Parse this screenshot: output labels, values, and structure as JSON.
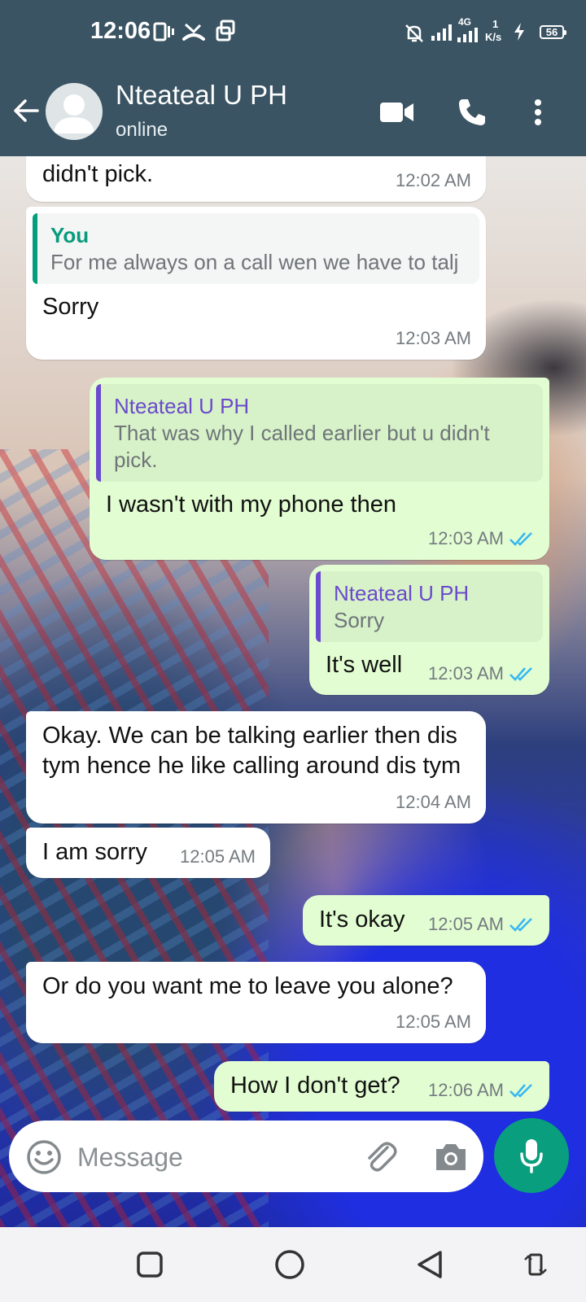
{
  "status_bar": {
    "time": "12:06",
    "network": "4G",
    "speed_value": "1",
    "speed_unit": "K/s",
    "battery": "56"
  },
  "header": {
    "contact_name": "Nteateal U PH",
    "contact_status": "online"
  },
  "messages": [
    {
      "text": "didn't pick.",
      "time": "12:02 AM"
    },
    {
      "quote_author": "You",
      "quote_text": "For me always on a call wen we have to talj",
      "text": "Sorry",
      "time": "12:03 AM"
    },
    {
      "quote_author": "Nteateal U PH",
      "quote_text": "That was why I called earlier but u didn't pick.",
      "text": "I wasn't with my phone then",
      "time": "12:03 AM"
    },
    {
      "quote_author": "Nteateal U PH",
      "quote_text": "Sorry",
      "text": "It's well",
      "time": "12:03 AM"
    },
    {
      "text": "Okay. We can be talking earlier then dis tym hence he like calling around dis tym",
      "time": "12:04 AM"
    },
    {
      "text": "I am sorry",
      "time": "12:05 AM"
    },
    {
      "text": "It's okay",
      "time": "12:05 AM"
    },
    {
      "text": "Or do you want me to leave you alone?",
      "time": "12:05 AM"
    },
    {
      "text": "How I don't get?",
      "time": "12:06 AM"
    }
  ],
  "input": {
    "placeholder": "Message"
  },
  "colors": {
    "header": "#3b5463",
    "outgoing_bubble": "#e2fdd2",
    "incoming_bubble": "#ffffff",
    "accent": "#099e7d",
    "read_ticks": "#34b7f1"
  }
}
